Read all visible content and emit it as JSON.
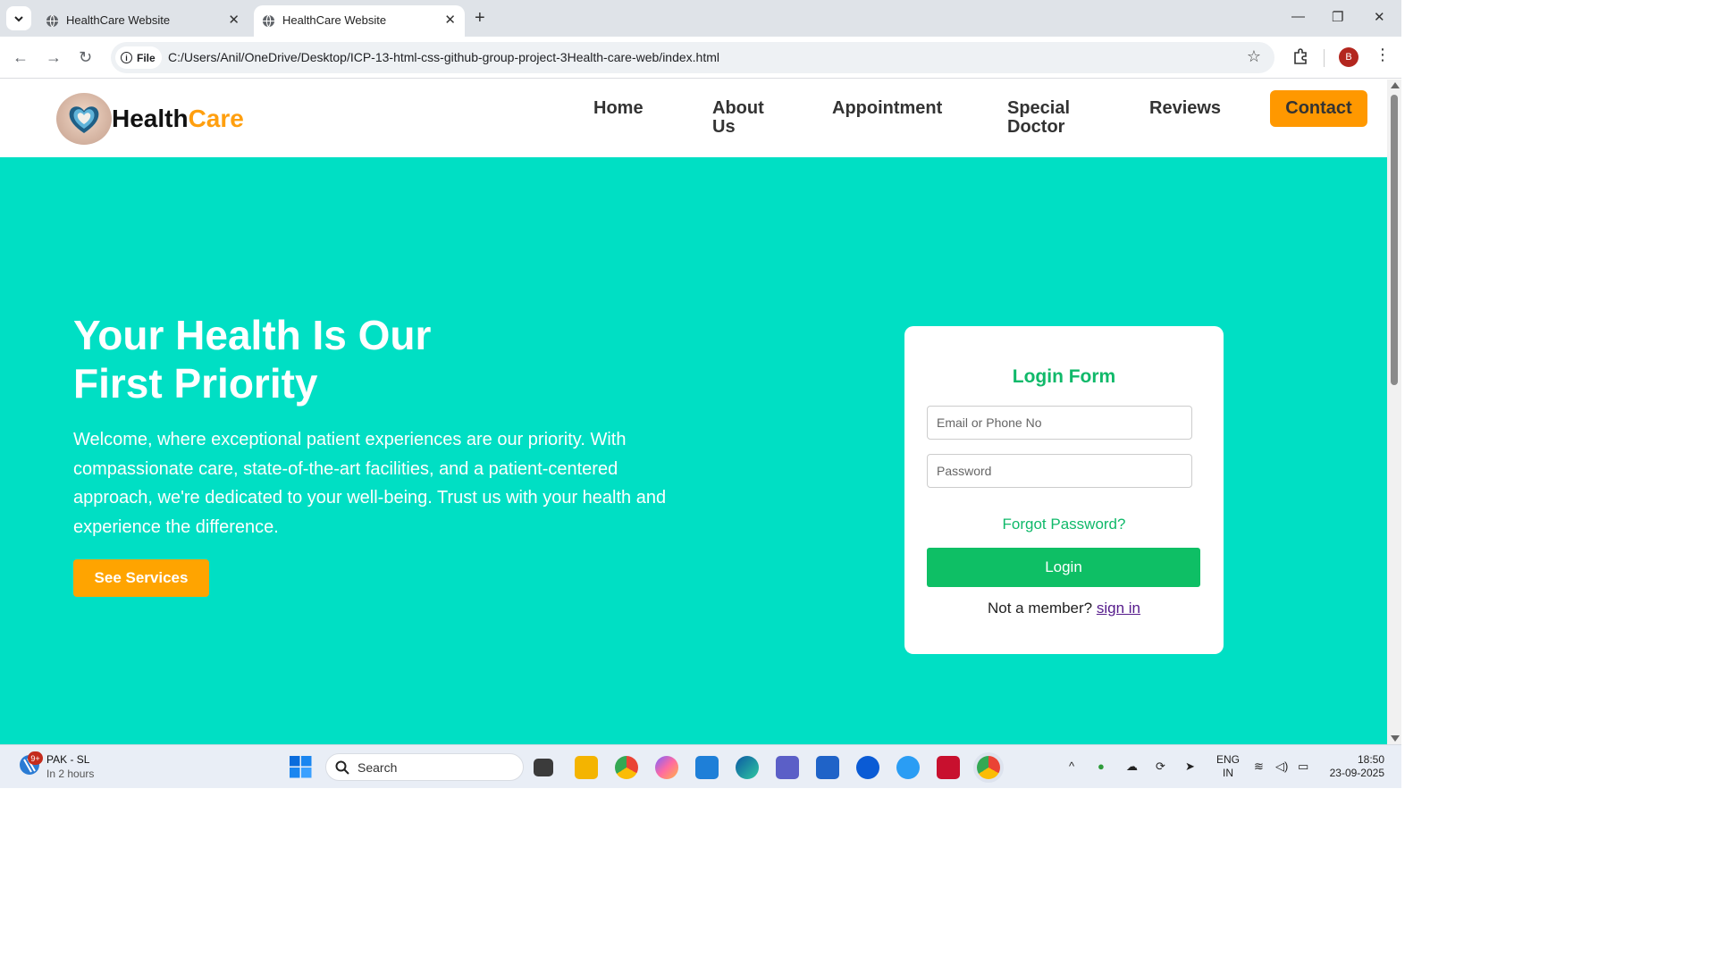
{
  "browser": {
    "tabs": [
      {
        "title": "HealthCare Website",
        "active": false
      },
      {
        "title": "HealthCare Website",
        "active": true
      }
    ],
    "chip_label": "File",
    "url": "C:/Users/Anil/OneDrive/Desktop/ICP-13-html-css-github-group-project-3Health-care-web/index.html",
    "profile_initial": "B"
  },
  "site": {
    "logo": {
      "part1": "Health",
      "part2": "Care"
    },
    "nav": {
      "home": "Home",
      "about_1": "About",
      "about_2": "Us",
      "appointment": "Appointment",
      "special_1": "Special",
      "special_2": "Doctor",
      "reviews": "Reviews",
      "contact": "Contact"
    },
    "hero": {
      "title_line1": "Your Health Is Our",
      "title_line2": "First Priority",
      "description": "Welcome, where exceptional patient experiences are our priority. With compassionate care, state-of-the-art facilities, and a patient-centered approach, we're dedicated to your well-being. Trust us with your health and experience the difference.",
      "cta": "See Services"
    },
    "login": {
      "title": "Login Form",
      "email_placeholder": "Email or Phone No",
      "password_placeholder": "Password",
      "forgot": "Forgot Password?",
      "button": "Login",
      "member_text": "Not a member?",
      "signin": "sign in"
    },
    "colors": {
      "hero_bg": "#00dfc4",
      "accent": "#ff9800",
      "green": "#0ebf65"
    }
  },
  "taskbar": {
    "weather_badge": "9+",
    "weather_title": "PAK - SL",
    "weather_sub": "In 2 hours",
    "search": "Search",
    "lang_1": "ENG",
    "lang_2": "IN",
    "time": "18:50",
    "date": "23-09-2025"
  }
}
